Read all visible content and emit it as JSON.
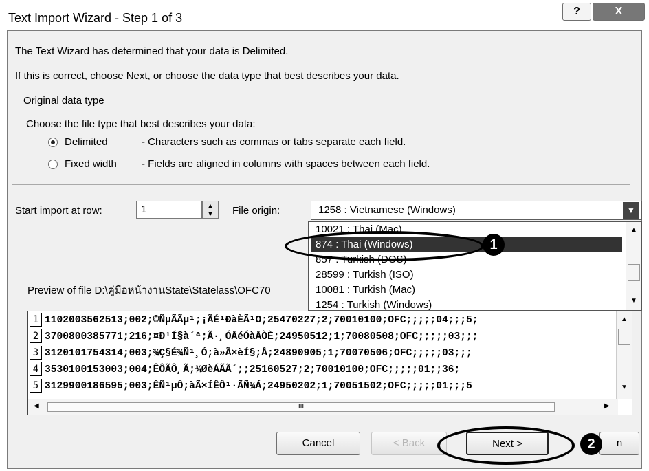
{
  "window": {
    "title": "Text Import Wizard - Step 1 of 3",
    "help_glyph": "?",
    "close_glyph": "X"
  },
  "intro": {
    "line1": "The Text Wizard has determined that your data is Delimited.",
    "line2": "If this is correct, choose Next, or choose the data type that best describes your data."
  },
  "original_data_type": {
    "group_label": "Original data type",
    "prompt": "Choose the file type that best describes your data:",
    "options": [
      {
        "label": "Delimited",
        "desc": "- Characters such as commas or tabs separate each field.",
        "selected": true
      },
      {
        "label": "Fixed width",
        "desc": "- Fields are aligned in columns with spaces between each field.",
        "selected": false
      }
    ]
  },
  "start_row": {
    "label": "Start import at row:",
    "value": "1"
  },
  "file_origin": {
    "label": "File origin:",
    "value": "1258 : Vietnamese (Windows)",
    "dropdown_items": [
      "10021 : Thai (Mac)",
      "874 : Thai (Windows)",
      "857 : Turkish (DOS)",
      "28599 : Turkish (ISO)",
      "10081 : Turkish (Mac)",
      "1254 : Turkish (Windows)"
    ],
    "selected_index": 1
  },
  "preview": {
    "label": "Preview of file D:\\คู่มือหน้างานState\\Statelass\\OFC70",
    "rows": [
      {
        "num": "1",
        "text": "1102003562513;002;©ÑµÃÃµ¹;¡ÃÉ¹ÐàÈÃ¹O;25470227;2;70010100;OFC;;;;;04;;;5;"
      },
      {
        "num": "2",
        "text": "3700800385771;216;¤Ð¹Í§à´ª;Ã·¸ÓÅéÓàÅÒÈ;24950512;1;70080508;OFC;;;;;03;;;"
      },
      {
        "num": "3",
        "text": "3120101754314;003;¾Ç§É¾Ñ¹¸Ó;à»Ã×èÍ§;Å;24890905;1;70070506;OFC;;;;;03;;;"
      },
      {
        "num": "4",
        "text": "3530100153003;004;ÊÔÃÔ¸Ã;¾ØèÁÃÃ´;;25160527;2;70010100;OFC;;;;;01;;36;"
      },
      {
        "num": "5",
        "text": "3129900186595;003;ÊÑ¹µÔ;àÃ×ÍÊÔ¹·ÃÑ¾Á;24950202;1;70051502;OFC;;;;;01;;;5"
      }
    ],
    "hscroll_glyph": "III"
  },
  "buttons": {
    "cancel": "Cancel",
    "back": "< Back",
    "next": "Next >",
    "finish": "n"
  },
  "callouts": [
    "1",
    "2"
  ]
}
